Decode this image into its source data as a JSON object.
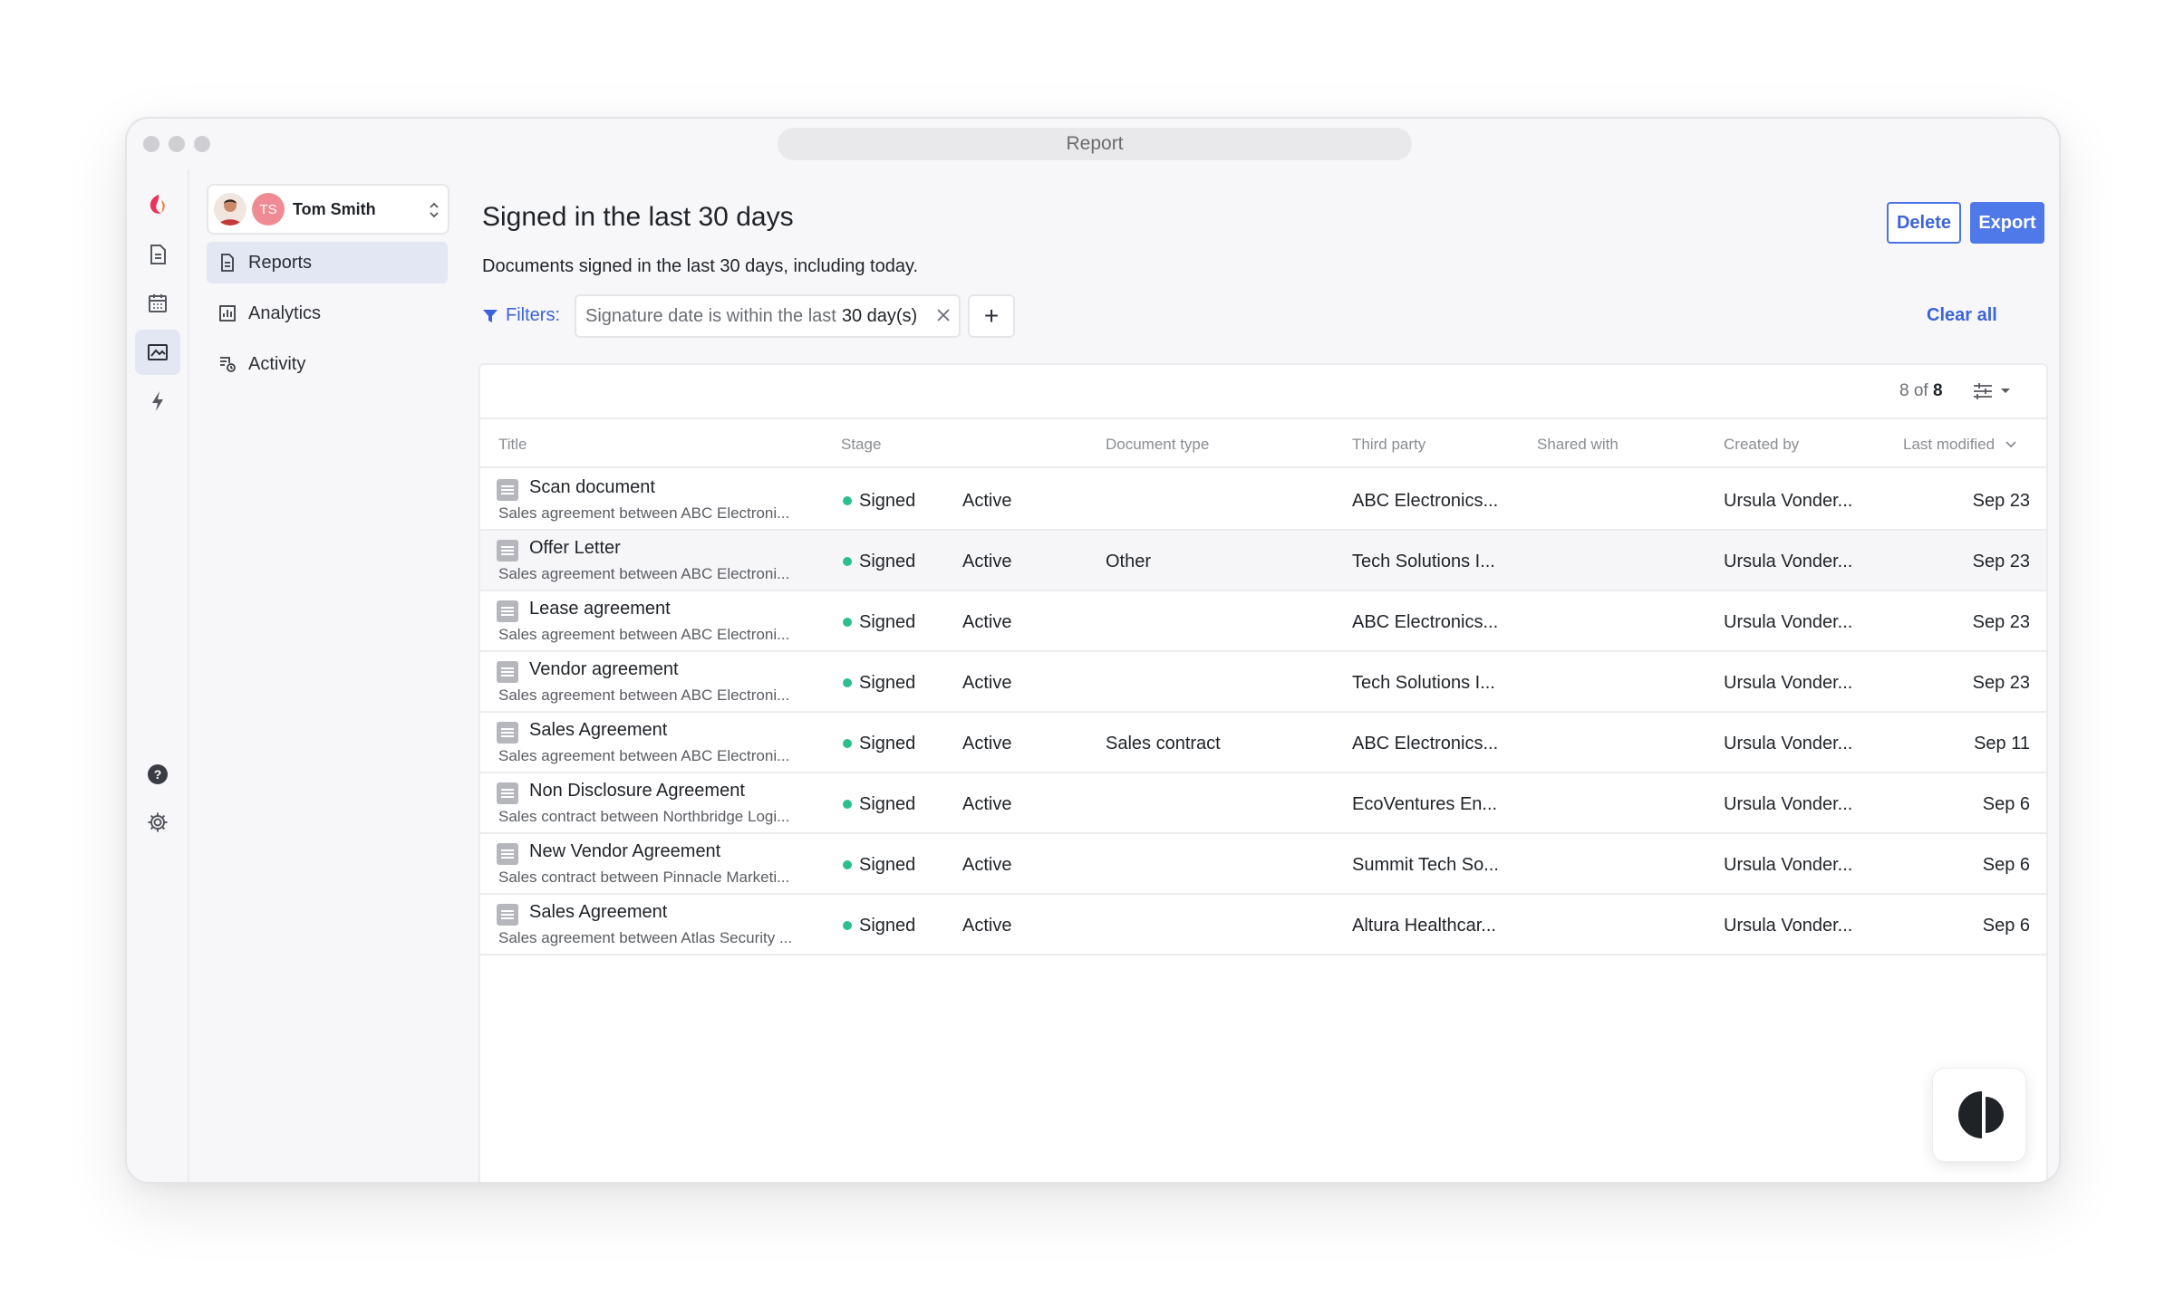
{
  "window": {
    "address_bar": "Report"
  },
  "org_switcher": {
    "initials": "TS",
    "name": "Tom Smith"
  },
  "subnav": [
    {
      "label": "Reports",
      "icon": "report-icon",
      "active": true
    },
    {
      "label": "Analytics",
      "icon": "bar-chart-icon",
      "active": false
    },
    {
      "label": "Activity",
      "icon": "activity-icon",
      "active": false
    }
  ],
  "header": {
    "title": "Signed in the last 30 days",
    "subtitle": "Documents signed in the last 30 days, including today.",
    "delete_label": "Delete",
    "export_label": "Export"
  },
  "filters": {
    "label": "Filters:",
    "chip_prefix": "Signature date is within the last",
    "chip_value": "30 day(s)",
    "add_label": "+",
    "clear_all": "Clear all"
  },
  "table": {
    "count_prefix": "8 of",
    "count_total": "8",
    "columns": [
      "Title",
      "Stage",
      "Document type",
      "Third party",
      "Shared with",
      "Created by",
      "Last modified"
    ],
    "rows": [
      {
        "title": "Scan document",
        "desc": "Sales agreement between ABC Electroni...",
        "stage": "Signed",
        "status": "Active",
        "doc_type": "",
        "third_party": "ABC Electronics...",
        "shared_with": "",
        "created_by": "Ursula Vonder...",
        "modified": "Sep 23"
      },
      {
        "title": "Offer Letter",
        "desc": "Sales agreement between ABC Electroni...",
        "stage": "Signed",
        "status": "Active",
        "doc_type": "Other",
        "third_party": "Tech Solutions I...",
        "shared_with": "",
        "created_by": "Ursula Vonder...",
        "modified": "Sep 23"
      },
      {
        "title": "Lease agreement",
        "desc": "Sales agreement between ABC Electroni...",
        "stage": "Signed",
        "status": "Active",
        "doc_type": "",
        "third_party": "ABC Electronics...",
        "shared_with": "",
        "created_by": "Ursula Vonder...",
        "modified": "Sep 23"
      },
      {
        "title": "Vendor agreement",
        "desc": "Sales agreement between ABC Electroni...",
        "stage": "Signed",
        "status": "Active",
        "doc_type": "",
        "third_party": "Tech Solutions I...",
        "shared_with": "",
        "created_by": "Ursula Vonder...",
        "modified": "Sep 23"
      },
      {
        "title": "Sales Agreement",
        "desc": "Sales agreement between ABC Electroni...",
        "stage": "Signed",
        "status": "Active",
        "doc_type": "Sales contract",
        "third_party": "ABC Electronics...",
        "shared_with": "",
        "created_by": "Ursula Vonder...",
        "modified": "Sep 11"
      },
      {
        "title": "Non Disclosure Agreement",
        "desc": "Sales contract between Northbridge Logi...",
        "stage": "Signed",
        "status": "Active",
        "doc_type": "",
        "third_party": "EcoVentures En...",
        "shared_with": "",
        "created_by": "Ursula Vonder...",
        "modified": "Sep 6"
      },
      {
        "title": "New Vendor Agreement",
        "desc": "Sales contract between Pinnacle Marketi...",
        "stage": "Signed",
        "status": "Active",
        "doc_type": "",
        "third_party": "Summit Tech So...",
        "shared_with": "",
        "created_by": "Ursula Vonder...",
        "modified": "Sep 6"
      },
      {
        "title": "Sales Agreement",
        "desc": "Sales agreement between Atlas Security ...",
        "stage": "Signed",
        "status": "Active",
        "doc_type": "",
        "third_party": "Altura Healthcar...",
        "shared_with": "",
        "created_by": "Ursula Vonder...",
        "modified": "Sep 6"
      }
    ]
  },
  "colors": {
    "accent": "#4f79e8",
    "signed_dot": "#2bbf8e",
    "brand": "#e8355a"
  }
}
